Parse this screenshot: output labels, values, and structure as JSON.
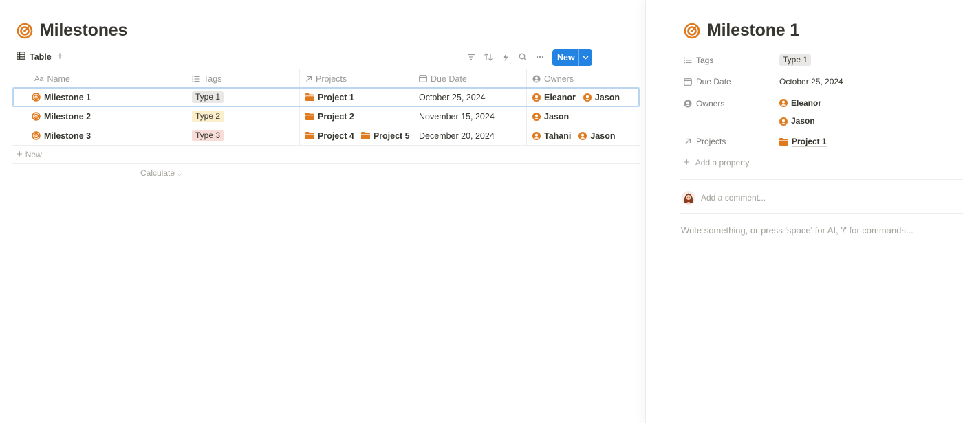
{
  "database": {
    "title": "Milestones",
    "view_tab": "Table",
    "new_button": "New",
    "columns": [
      "Name",
      "Tags",
      "Projects",
      "Due Date",
      "Owners"
    ],
    "name_prefix": "Aa",
    "rows": [
      {
        "name": "Milestone 1",
        "tag": "Type 1",
        "tag_color": "gray",
        "projects": [
          "Project 1"
        ],
        "due": "October 25, 2024",
        "owners": [
          "Eleanor",
          "Jason"
        ],
        "selected": true
      },
      {
        "name": "Milestone 2",
        "tag": "Type 2",
        "tag_color": "yellow",
        "projects": [
          "Project 2"
        ],
        "due": "November 15, 2024",
        "owners": [
          "Jason"
        ],
        "selected": false
      },
      {
        "name": "Milestone 3",
        "tag": "Type 3",
        "tag_color": "red",
        "projects": [
          "Project 4",
          "Project 5"
        ],
        "due": "December 20, 2024",
        "owners": [
          "Tahani",
          "Jason"
        ],
        "selected": false
      }
    ],
    "new_row": "New",
    "calculate": "Calculate"
  },
  "peek": {
    "title": "Milestone 1",
    "props": {
      "tags_label": "Tags",
      "tags_value": "Type 1",
      "due_label": "Due Date",
      "due_value": "October 25, 2024",
      "owners_label": "Owners",
      "owner_1": "Eleanor",
      "owner_2": "Jason",
      "projects_label": "Projects",
      "projects_value": "Project 1"
    },
    "add_property": "Add a property",
    "comment_placeholder": "Add a comment...",
    "body_placeholder": "Write something, or press 'space' for AI, '/' for commands..."
  },
  "colors": {
    "accent": "#2383e2",
    "icon_orange": "#e07a1f",
    "text": "#37352f",
    "muted": "#9b9a97"
  }
}
